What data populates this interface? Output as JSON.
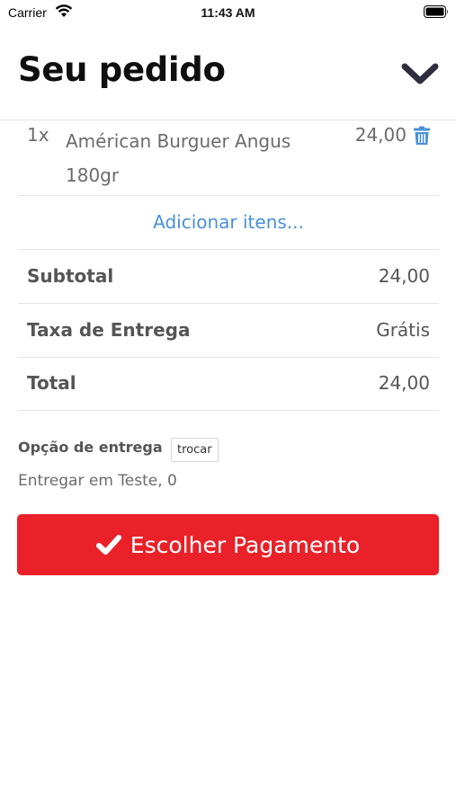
{
  "status_bar": {
    "carrier": "Carrier",
    "time": "11:43 AM"
  },
  "header": {
    "title": "Seu pedido",
    "collapse_icon": "chevron-down-icon"
  },
  "order_items": [
    {
      "qty": "1x",
      "name": "Américan Burguer Angus 180gr",
      "price": "24,00",
      "delete_icon": "trash-icon"
    }
  ],
  "add_items_label": "Adicionar itens...",
  "summary": {
    "subtotal_label": "Subtotal",
    "subtotal_value": "24,00",
    "delivery_fee_label": "Taxa de Entrega",
    "delivery_fee_value": "Grátis",
    "total_label": "Total",
    "total_value": "24,00"
  },
  "delivery": {
    "label": "Opção de entrega",
    "change_label": "trocar",
    "address": "Entregar em Teste, 0"
  },
  "payment_button": {
    "label": "Escolher Pagamento",
    "icon": "check-icon"
  },
  "colors": {
    "primary_button": "#ea2128",
    "link": "#4a90d9",
    "trash": "#4a90d9"
  }
}
